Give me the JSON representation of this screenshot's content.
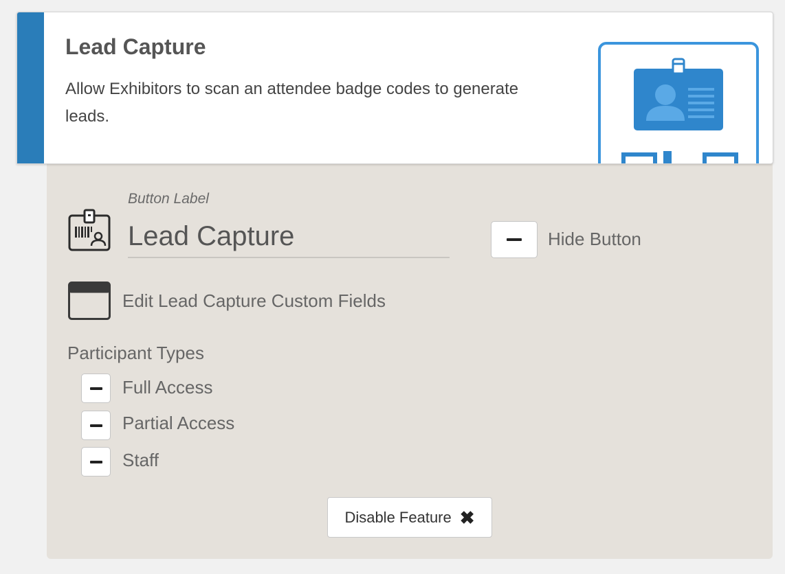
{
  "feature": {
    "title": "Lead Capture",
    "description": "Allow Exhibitors to scan an attendee badge codes to generate leads.",
    "accent_color": "#2a7db9",
    "image_icon": "badge-scanner-illustration"
  },
  "button_label": {
    "caption": "Button Label",
    "value": "Lead Capture",
    "icon": "badge-barcode-icon"
  },
  "hide_button": {
    "label": "Hide Button",
    "state": "indeterminate"
  },
  "custom_fields": {
    "label": "Edit Lead Capture Custom Fields",
    "icon": "window-icon"
  },
  "participant_types": {
    "heading": "Participant Types",
    "items": [
      {
        "label": "Full Access",
        "state": "indeterminate"
      },
      {
        "label": "Partial Access",
        "state": "indeterminate"
      },
      {
        "label": "Staff",
        "state": "indeterminate"
      }
    ]
  },
  "actions": {
    "disable_label": "Disable Feature",
    "disable_icon": "close-icon"
  },
  "colors": {
    "panel_bg": "#e5e1db",
    "page_bg": "#f1f1f1"
  }
}
